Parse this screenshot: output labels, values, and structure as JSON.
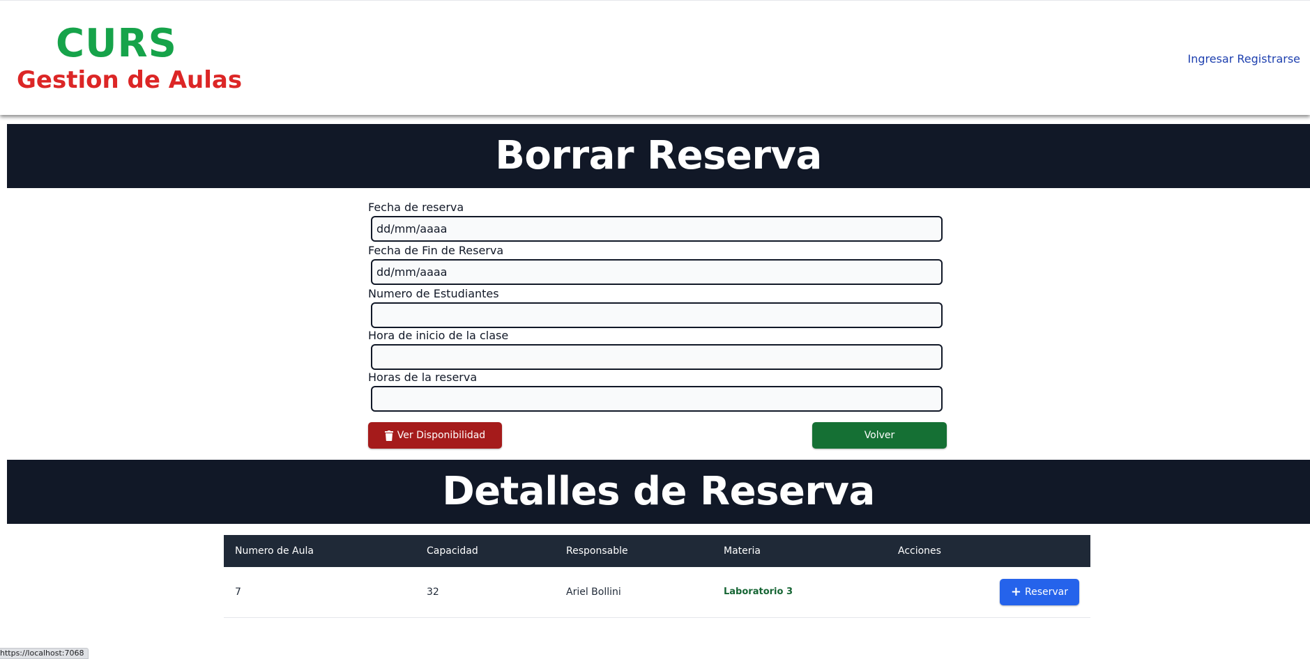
{
  "header": {
    "brand_title": "CURS",
    "brand_subtitle": "Gestion de Aulas",
    "nav": {
      "login": "Ingresar",
      "register": "Registrarse"
    }
  },
  "form_section": {
    "title": "Borrar Reserva",
    "fields": [
      {
        "label": "Fecha de reserva",
        "value": "",
        "placeholder": "dd/mm/aaaa"
      },
      {
        "label": "Fecha de Fin de Reserva",
        "value": "",
        "placeholder": "dd/mm/aaaa"
      },
      {
        "label": "Numero de Estudiantes",
        "value": "",
        "placeholder": ""
      },
      {
        "label": "Hora de inicio de la clase",
        "value": "",
        "placeholder": ""
      },
      {
        "label": "Horas de la reserva",
        "value": "",
        "placeholder": ""
      }
    ],
    "buttons": {
      "check_availability": "Ver Disponibilidad",
      "back": "Volver"
    }
  },
  "details_section": {
    "title": "Detalles de Reserva",
    "columns": [
      "Numero de Aula",
      "Capacidad",
      "Responsable",
      "Materia",
      "Acciones"
    ],
    "rows": [
      {
        "aula": "7",
        "capacidad": "32",
        "responsable": "Ariel Bollini",
        "materia": "Laboratorio 3",
        "action_label": "Reservar"
      }
    ]
  },
  "status_bar": {
    "url": "https://localhost:7068"
  },
  "icons": {
    "check_availability": "trash-icon",
    "reservar": "plus-icon"
  },
  "colors": {
    "brand_green": "#16a34a",
    "brand_red": "#dc2626",
    "banner_bg": "#111827",
    "danger_button": "#a51b1b",
    "success_button": "#157034",
    "primary_button": "#2563eb",
    "table_header_bg": "#1f2937"
  }
}
